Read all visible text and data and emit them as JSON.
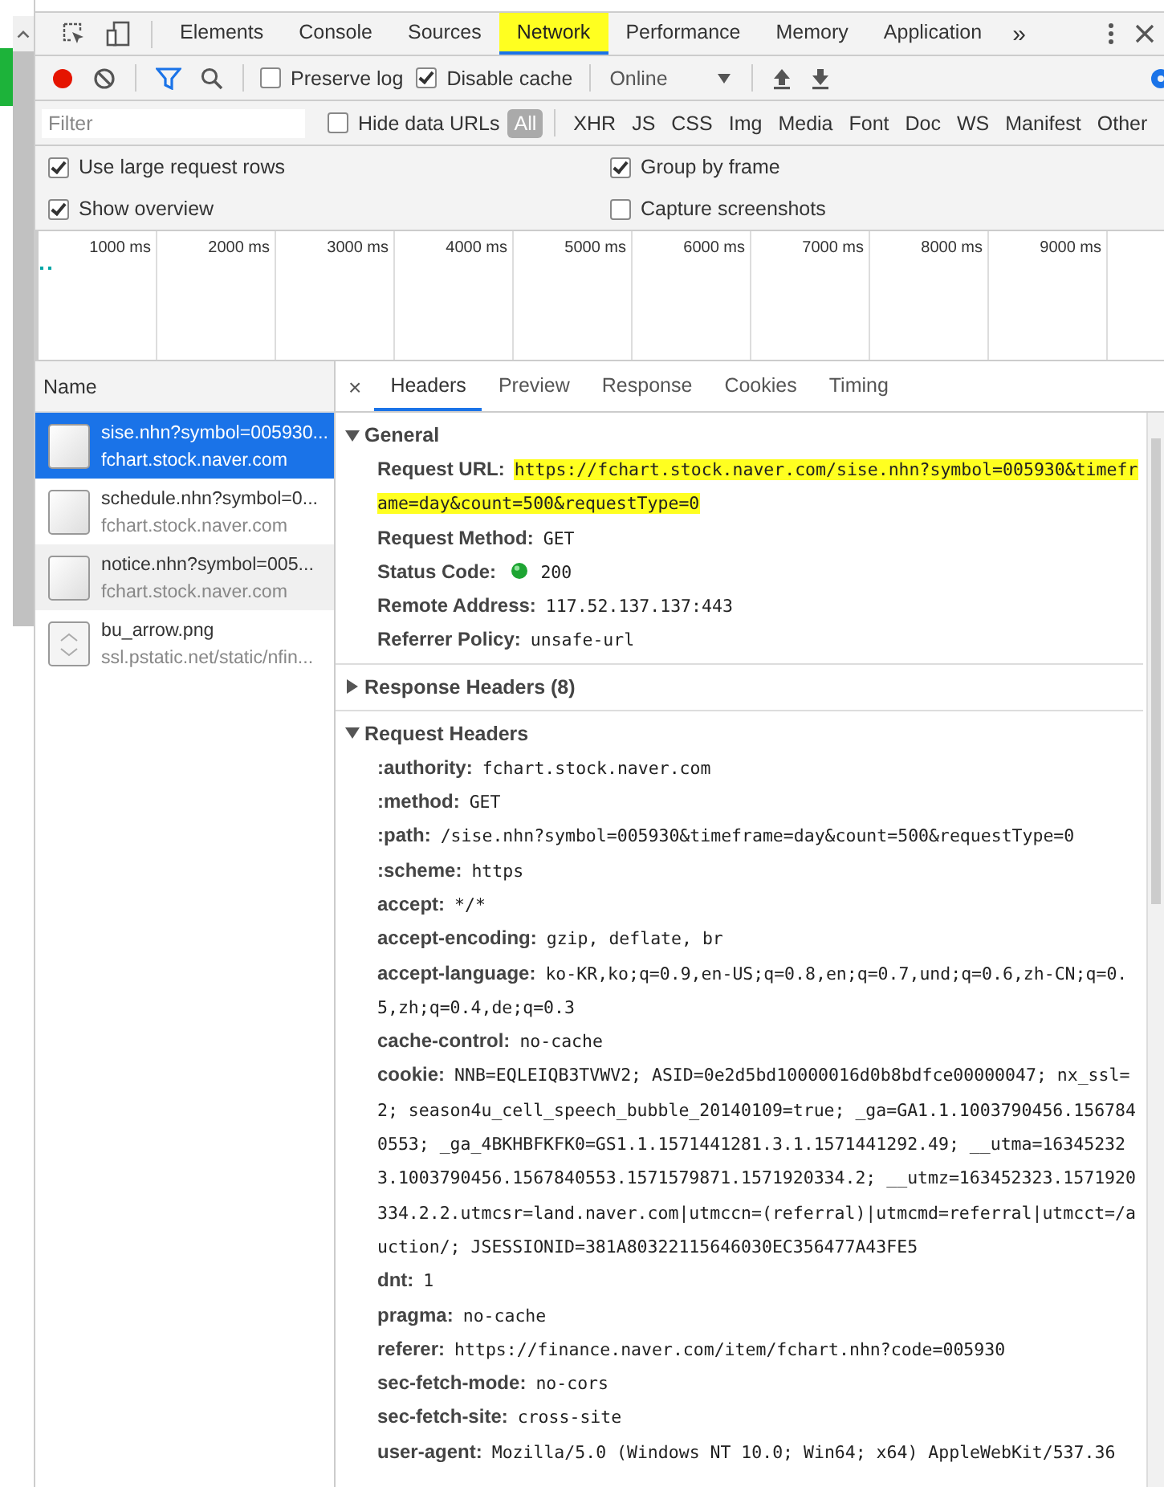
{
  "tabs": [
    {
      "label": "Elements",
      "selected": false
    },
    {
      "label": "Console",
      "selected": false
    },
    {
      "label": "Sources",
      "selected": false
    },
    {
      "label": "Network",
      "selected": true
    },
    {
      "label": "Performance",
      "selected": false
    },
    {
      "label": "Memory",
      "selected": false
    },
    {
      "label": "Application",
      "selected": false
    }
  ],
  "more_tabs": "»",
  "toolbar": {
    "recording": true,
    "preserve_log": {
      "label": "Preserve log",
      "checked": false
    },
    "disable_cache": {
      "label": "Disable cache",
      "checked": true
    },
    "throttling": "Online"
  },
  "filter": {
    "placeholder": "Filter",
    "hide_data_urls": {
      "label": "Hide data URLs",
      "checked": false
    },
    "types": [
      {
        "label": "All",
        "selected": true
      },
      {
        "label": "XHR",
        "selected": false
      },
      {
        "label": "JS",
        "selected": false
      },
      {
        "label": "CSS",
        "selected": false
      },
      {
        "label": "Img",
        "selected": false
      },
      {
        "label": "Media",
        "selected": false
      },
      {
        "label": "Font",
        "selected": false
      },
      {
        "label": "Doc",
        "selected": false
      },
      {
        "label": "WS",
        "selected": false
      },
      {
        "label": "Manifest",
        "selected": false
      },
      {
        "label": "Other",
        "selected": false
      }
    ]
  },
  "options": [
    {
      "label": "Use large request rows",
      "checked": true
    },
    {
      "label": "Group by frame",
      "checked": true
    },
    {
      "label": "Show overview",
      "checked": true
    },
    {
      "label": "Capture screenshots",
      "checked": false
    }
  ],
  "overview": {
    "ticks": [
      "1000 ms",
      "2000 ms",
      "3000 ms",
      "4000 ms",
      "5000 ms",
      "6000 ms",
      "7000 ms",
      "8000 ms",
      "9000 ms"
    ]
  },
  "requests": {
    "column": "Name",
    "rows": [
      {
        "name": "sise.nhn?symbol=005930...",
        "domain": "fchart.stock.naver.com",
        "kind": "document",
        "selected": true,
        "hovered": false
      },
      {
        "name": "schedule.nhn?symbol=0...",
        "domain": "fchart.stock.naver.com",
        "kind": "document",
        "selected": false,
        "hovered": false
      },
      {
        "name": "notice.nhn?symbol=005...",
        "domain": "fchart.stock.naver.com",
        "kind": "document",
        "selected": false,
        "hovered": true
      },
      {
        "name": "bu_arrow.png",
        "domain": "ssl.pstatic.net/static/nfin...",
        "kind": "image",
        "selected": false,
        "hovered": false
      }
    ]
  },
  "details": {
    "close": "×",
    "tabs": [
      {
        "label": "Headers",
        "selected": true
      },
      {
        "label": "Preview",
        "selected": false
      },
      {
        "label": "Response",
        "selected": false
      },
      {
        "label": "Cookies",
        "selected": false
      },
      {
        "label": "Timing",
        "selected": false
      }
    ],
    "sections": [
      {
        "title": "General",
        "expanded": true,
        "items": [
          {
            "key": "Request URL:",
            "value": "https://fchart.stock.naver.com/sise.nhn?symbol=005930&timeframe=day&count=500&requestType=0",
            "kind": "text",
            "highlighted": true
          },
          {
            "key": "Request Method:",
            "value": "GET",
            "kind": "text",
            "highlighted": false
          },
          {
            "key": "Status Code:",
            "value": "200",
            "kind": "status",
            "highlighted": false
          },
          {
            "key": "Remote Address:",
            "value": "117.52.137.137:443",
            "kind": "text",
            "highlighted": false
          },
          {
            "key": "Referrer Policy:",
            "value": "unsafe-url",
            "kind": "text",
            "highlighted": false
          }
        ]
      },
      {
        "title": "Response Headers (8)",
        "expanded": false
      },
      {
        "title": "Request Headers",
        "expanded": true,
        "items": [
          {
            "key": ":authority:",
            "value": "fchart.stock.naver.com",
            "kind": "text",
            "highlighted": false
          },
          {
            "key": ":method:",
            "value": "GET",
            "kind": "text",
            "highlighted": false
          },
          {
            "key": ":path:",
            "value": "/sise.nhn?symbol=005930&timeframe=day&count=500&requestType=0",
            "kind": "text",
            "highlighted": false
          },
          {
            "key": ":scheme:",
            "value": "https",
            "kind": "text",
            "highlighted": false
          },
          {
            "key": "accept:",
            "value": "*/*",
            "kind": "text",
            "highlighted": false
          },
          {
            "key": "accept-encoding:",
            "value": "gzip, deflate, br",
            "kind": "text",
            "highlighted": false
          },
          {
            "key": "accept-language:",
            "value": "ko-KR,ko;q=0.9,en-US;q=0.8,en;q=0.7,und;q=0.6,zh-CN;q=0.5,zh;q=0.4,de;q=0.3",
            "kind": "text",
            "highlighted": false
          },
          {
            "key": "cache-control:",
            "value": "no-cache",
            "kind": "text",
            "highlighted": false
          },
          {
            "key": "cookie:",
            "value": "NNB=EQLEIQB3TVWV2; ASID=0e2d5bd10000016d0b8bdfce00000047; nx_ssl=2; season4u_cell_speech_bubble_20140109=true; _ga=GA1.1.1003790456.1567840553; _ga_4BKHBFKFK0=GS1.1.1571441281.3.1.1571441292.49; __utma=163452323.1003790456.1567840553.1571579871.1571920334.2; __utmz=163452323.1571920334.2.2.utmcsr=land.naver.com|utmccn=(referral)|utmcmd=referral|utmcct=/auction/; JSESSIONID=381A80322115646030EC356477A43FE5",
            "kind": "text",
            "highlighted": false
          },
          {
            "key": "dnt:",
            "value": "1",
            "kind": "text",
            "highlighted": false
          },
          {
            "key": "pragma:",
            "value": "no-cache",
            "kind": "text",
            "highlighted": false
          },
          {
            "key": "referer:",
            "value": "https://finance.naver.com/item/fchart.nhn?code=005930",
            "kind": "text",
            "highlighted": false
          },
          {
            "key": "sec-fetch-mode:",
            "value": "no-cors",
            "kind": "text",
            "highlighted": false
          },
          {
            "key": "sec-fetch-site:",
            "value": "cross-site",
            "kind": "text",
            "highlighted": false
          },
          {
            "key": "user-agent:",
            "value": "Mozilla/5.0 (Windows NT 10.0; Win64; x64) AppleWebKit/537.36",
            "kind": "text",
            "highlighted": false
          }
        ]
      }
    ]
  }
}
